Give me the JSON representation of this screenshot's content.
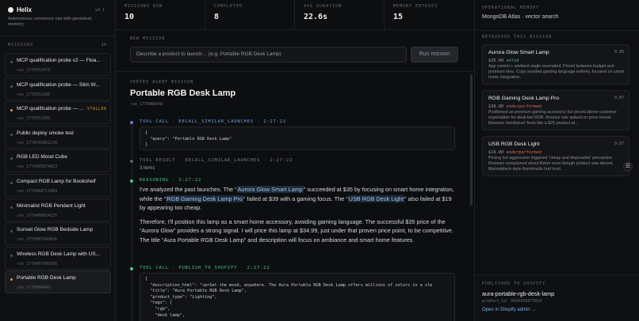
{
  "sidebar": {
    "brand": "Helix",
    "version": "v0.1",
    "tagline": "Autonomous commerce ops with persistent memory",
    "missions_label": "MISSIONS",
    "missions_count": "10",
    "missions": [
      {
        "title": "MCP qualification probe v2 — Floa...",
        "id": "run_1778552479",
        "dot": "grey",
        "badge": ""
      },
      {
        "title": "MCP qualification probe — Slim W...",
        "id": "run_1778552436",
        "dot": "grey",
        "badge": ""
      },
      {
        "title": "MCP qualification probe — ...",
        "id": "run_1778552689",
        "dot": "amber",
        "badge": "STALLED"
      },
      {
        "title": "Public deploy smoke test",
        "id": "run_1778545881156",
        "dot": "grey",
        "badge": ""
      },
      {
        "title": "RGB LED Mood Cube",
        "id": "run_1778485874813",
        "dot": "grey",
        "badge": ""
      },
      {
        "title": "Compact RGB Lamp for Bookshelf",
        "id": "run_1778488711884",
        "dot": "grey",
        "badge": ""
      },
      {
        "title": "Minimalist RGB Pendant Light",
        "id": "run_1778488814125",
        "dot": "grey",
        "badge": ""
      },
      {
        "title": "Sunset Glow RGB Bedside Lamp",
        "id": "run_1778487544836",
        "dot": "grey",
        "badge": ""
      },
      {
        "title": "Wireless RGB Desk Lamp with US...",
        "id": "run_1778487089266",
        "dot": "grey",
        "badge": ""
      },
      {
        "title": "Portable RGB Desk Lamp",
        "id": "run_1778486443",
        "dot": "amber",
        "badge": ""
      }
    ]
  },
  "stats": [
    {
      "label": "MISSIONS RUN",
      "value": "10"
    },
    {
      "label": "COMPLETED",
      "value": "8"
    },
    {
      "label": "AVG DURATION",
      "value": "22.6s"
    },
    {
      "label": "MEMORY ENTRIES",
      "value": "15"
    }
  ],
  "new_mission": {
    "label": "NEW MISSION",
    "placeholder": "Describe a product to launch… (e.g. Portable RGB Desk Lamp)",
    "button": "Run mission"
  },
  "mission": {
    "agent_label": "VERTEX AGENT MISSION",
    "title": "Portable RGB Desk Lamp",
    "id": "run_1778486442",
    "events": {
      "call1_head": "TOOL CALL · RECALL_SIMILAR_LAUNCHES · 2:27:22",
      "call1_code": "{\n  \"query\": \"Portable RGB Desk Lamp\"\n}",
      "result1_head": "TOOL RESULT · RECALL_SIMILAR_LAUNCHES · 2:27:22",
      "result1_items": "3 items",
      "reasoning_head": "REASONING · 2:27:22",
      "r1_a": "I've analyzed the past launches. The “",
      "r1_h1": "Aurora Glow Smart Lamp",
      "r1_b": "” succeeded at $35 by focusing on smart home integration, while the “",
      "r1_h2": "RGB Gaming Desk Lamp Pro",
      "r1_c": "” failed at $39 with a gaming focus. The “",
      "r1_h3": "USB RGB Desk Light",
      "r1_d": "” also failed at $19 by appearing too cheap.",
      "r2": "Therefore, I'll position this lamp as a smart home accessory, avoiding gaming language. The successful $35 price of the “Aurora Glow” provides a strong signal. I will price this lamp at $34.99, just under that proven price point, to be competitive. The title “Aura Portable RGB Desk Lamp” and description will focus on ambiance and smart home features.",
      "call2_head": "TOOL CALL · PUBLISH_TO_SHOPIFY · 2:27:22",
      "call2_code": "{\n  \"description_html\": \"<p>Set the mood, anywhere. The Aura Portable RGB Desk Lamp offers millions of colors in a sle\n  \"title\": \"Aura Portable RGB Desk Lamp\",\n  \"product_type\": \"Lighting\",\n  \"tags\": [\n    \"rgb\",\n    \"desk lamp\","
    }
  },
  "right": {
    "memory_label": "OPERATIONAL MEMORY",
    "memory_value": "MongoDB Atlas · vector search",
    "retrieved_label": "RETRIEVED THIS MISSION",
    "cards": [
      {
        "title": "Aurora Glow Smart Lamp",
        "score": "0.88",
        "price": "$35.00",
        "status": "solid",
        "status_class": "solid",
        "desc": "App control + ambient angle resonated. Priced between budget and premium tiers. Copy avoided gaming language entirely, focused on smart home integration."
      },
      {
        "title": "RGB Gaming Desk Lamp Pro",
        "score": "0.87",
        "price": "$39.00",
        "status": "underperformed",
        "status_class": "under",
        "desc": "Positioned as premium gaming accessory but priced above customer expectation for desk-tier RGB. Bounce rate spiked on price reveal. Reviews mentioned 'feels like a $25 product at..."
      },
      {
        "title": "USB RGB Desk Light",
        "score": "0.87",
        "price": "$19.00",
        "status": "underperformed",
        "status_class": "under",
        "desc": "Pricing too aggressive triggered 'cheap and disposable' perception. Reviews complained about flicker even though product was decent. Marketplace-style thumbnails hurt trust."
      }
    ],
    "published_label": "PUBLISHED TO SHOPIFY",
    "handle": "aura-portable-rgb-desk-lamp",
    "product_id": "product_id: 9426189973019",
    "admin_link": "Open in Shopify admin →"
  },
  "colors": {
    "accent_blue": "#6aa6e8",
    "green": "#4fc48a",
    "amber": "#d99a2b",
    "red": "#e06a5a"
  },
  "icons": {
    "settings": "sliders-icon"
  }
}
